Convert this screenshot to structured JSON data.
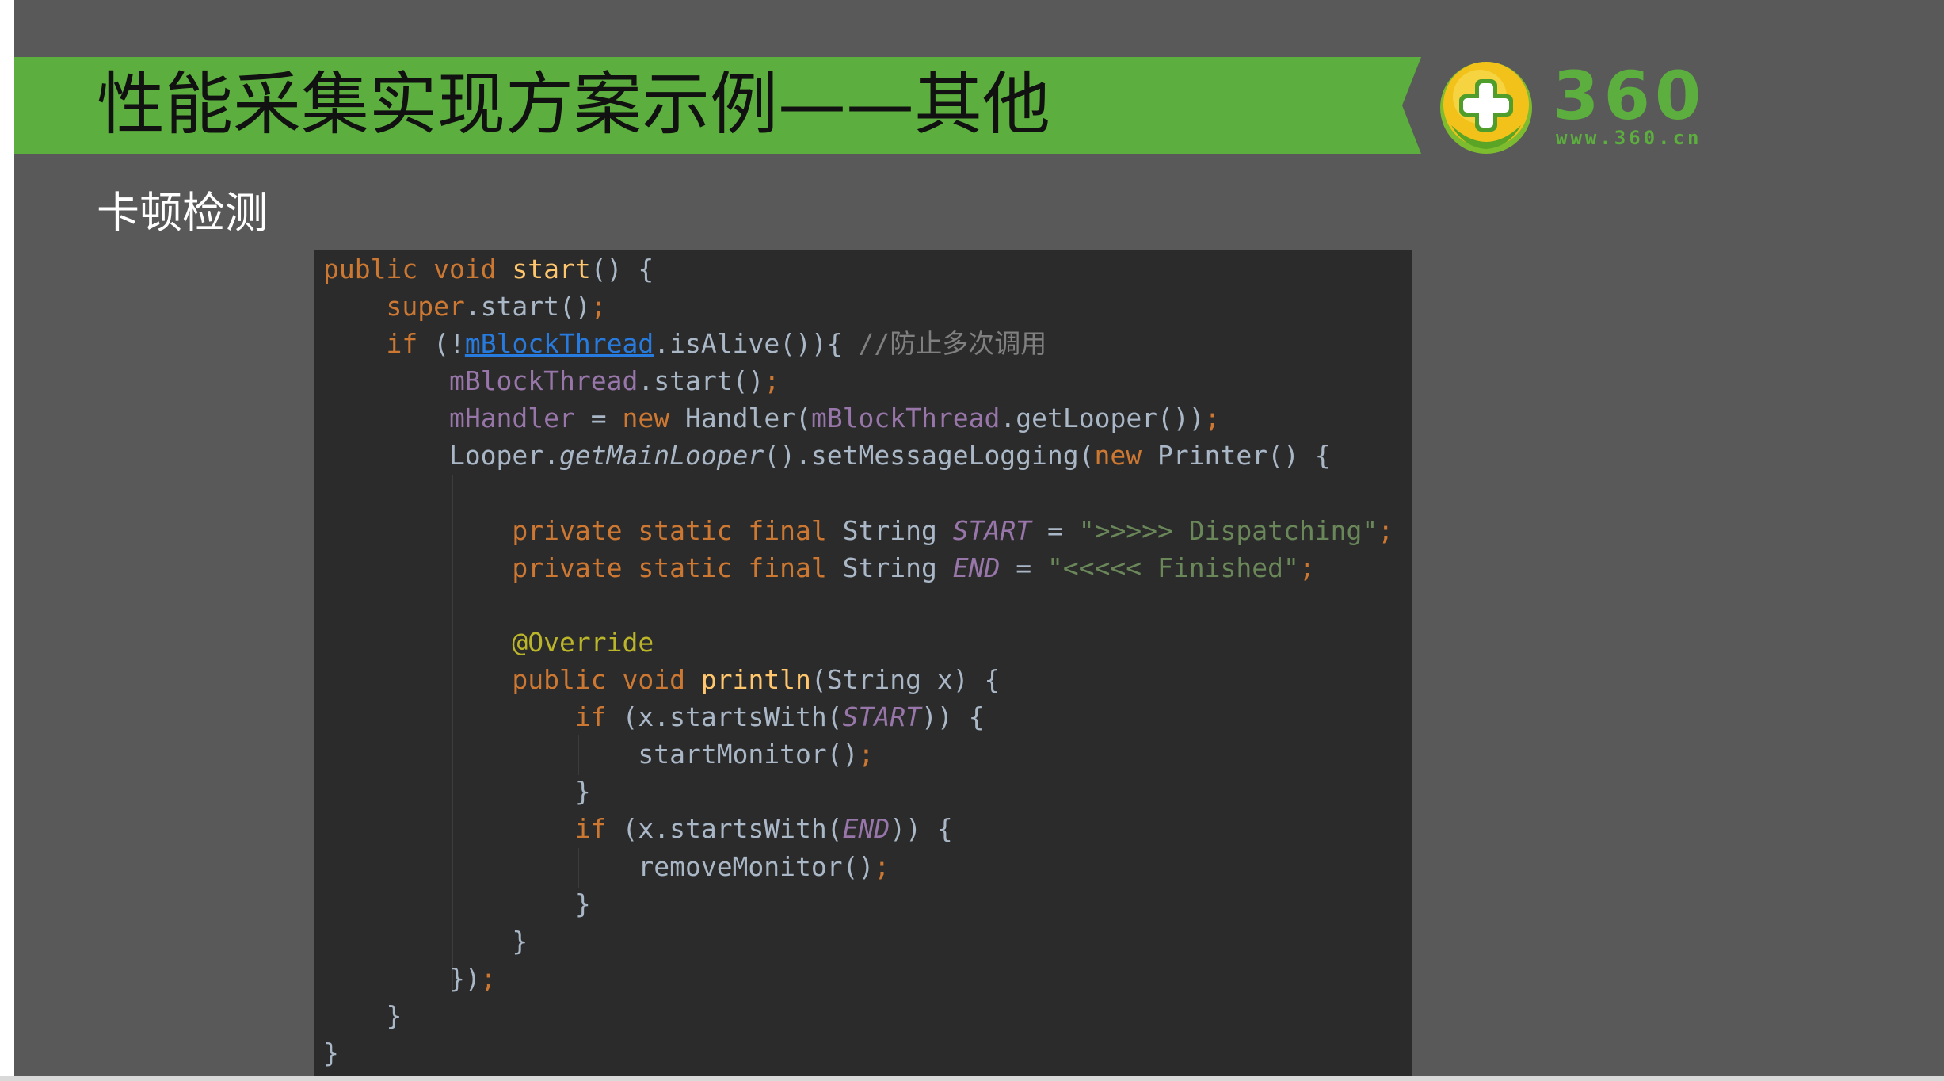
{
  "slide": {
    "title": "性能采集实现方案示例——其他",
    "subtitle": "卡顿检测"
  },
  "logo": {
    "number": "360",
    "url": "www.360.cn"
  },
  "code": {
    "lines": [
      "public void start() {",
      "    super.start();",
      "    if (!mBlockThread.isAlive()){ //防止多次调用",
      "        mBlockThread.start();",
      "        mHandler = new Handler(mBlockThread.getLooper());",
      "        Looper.getMainLooper().setMessageLogging(new Printer() {",
      "",
      "            private static final String START = \">>>>> Dispatching\";",
      "            private static final String END = \"<<<<< Finished\";",
      "",
      "            @Override",
      "            public void println(String x) {",
      "                if (x.startsWith(START)) {",
      "                    startMonitor();",
      "                }",
      "                if (x.startsWith(END)) {",
      "                    removeMonitor();",
      "                }",
      "            }",
      "        });",
      "    }",
      "}"
    ]
  },
  "colors": {
    "title_bar": "#5cae3e",
    "code_background": "#2b2b2b",
    "keyword": "#cc7832",
    "method": "#ffc66d",
    "field": "#9876aa",
    "string": "#6a8759",
    "comment": "#808080",
    "annotation": "#bbb529"
  }
}
